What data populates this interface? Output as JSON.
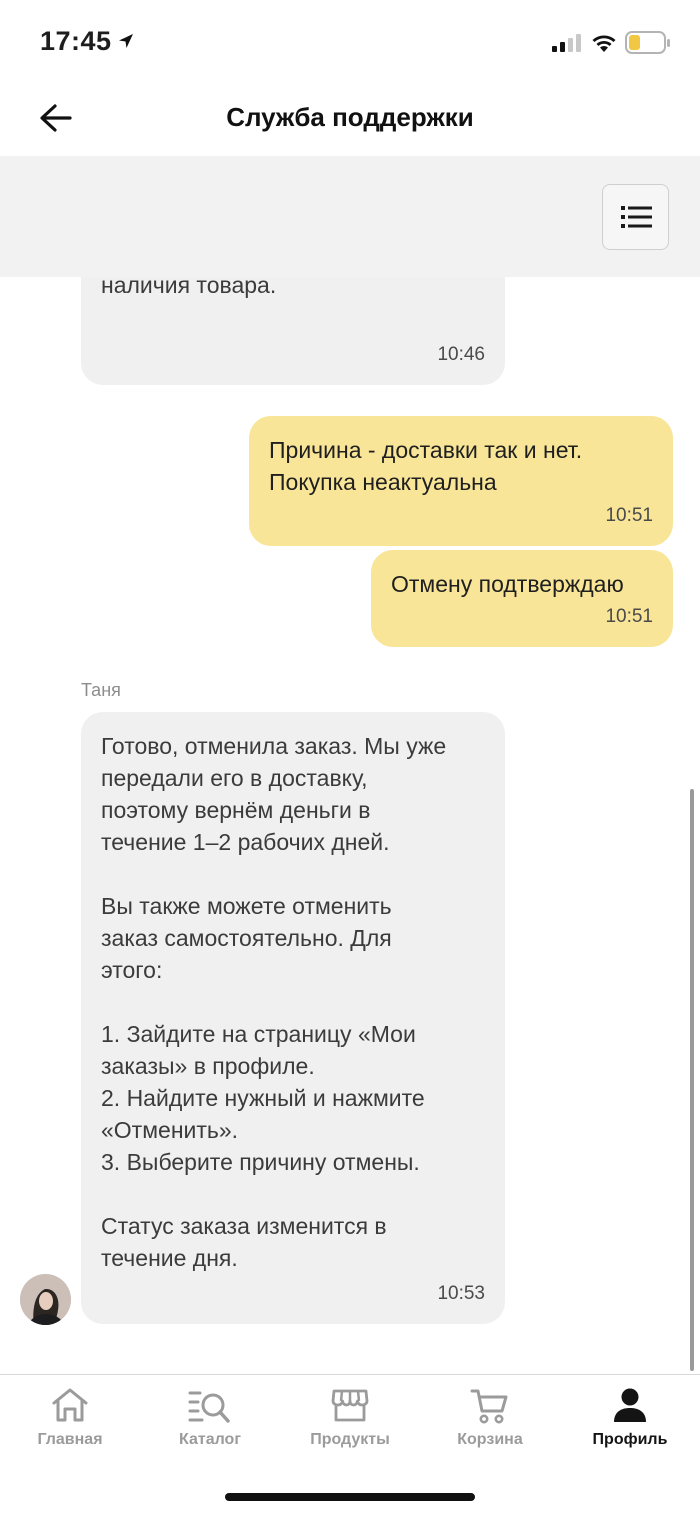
{
  "status_bar": {
    "time": "17:45",
    "icons": [
      "location-arrow-icon",
      "signal-icon",
      "wifi-icon",
      "battery-low-icon"
    ],
    "battery_color": "#f2c744"
  },
  "header": {
    "title": "Служба поддержки",
    "back_icon": "arrow-left-icon"
  },
  "toolbar": {
    "menu_icon": "list-icon"
  },
  "chat": {
    "messages": [
      {
        "direction": "incoming",
        "text": "меняется стоимость или статус\nналичия товара.",
        "time": "10:46"
      },
      {
        "direction": "outgoing",
        "text": "Причина - доставки так и нет.\nПокупка неактуальна",
        "time": "10:51"
      },
      {
        "direction": "outgoing",
        "text": "Отмену подтверждаю",
        "time": "10:51"
      },
      {
        "direction": "incoming",
        "sender": "Таня",
        "text": "Готово, отменила заказ. Мы уже\nпередали его в доставку,\nпоэтому вернём деньги в\nтечение 1–2 рабочих дней.\n\nВы также можете отменить\nзаказ самостоятельно. Для\nэтого:\n\n1. Зайдите на страницу «Мои\nзаказы» в профиле.\n2. Найдите нужный и нажмите\n«Отменить».\n3. Выберите причину отмены.\n\nСтатус заказа изменится в\nтечение дня.",
        "time": "10:53"
      }
    ],
    "colors": {
      "incoming_bubble": "#f0f0f0",
      "outgoing_bubble": "#f8e597"
    }
  },
  "tab_bar": {
    "tabs": [
      {
        "label": "Главная",
        "icon": "home-icon",
        "active": false
      },
      {
        "label": "Каталог",
        "icon": "catalog-search-icon",
        "active": false
      },
      {
        "label": "Продукты",
        "icon": "store-icon",
        "active": false
      },
      {
        "label": "Корзина",
        "icon": "cart-icon",
        "active": false
      },
      {
        "label": "Профиль",
        "icon": "profile-icon",
        "active": true
      }
    ]
  }
}
